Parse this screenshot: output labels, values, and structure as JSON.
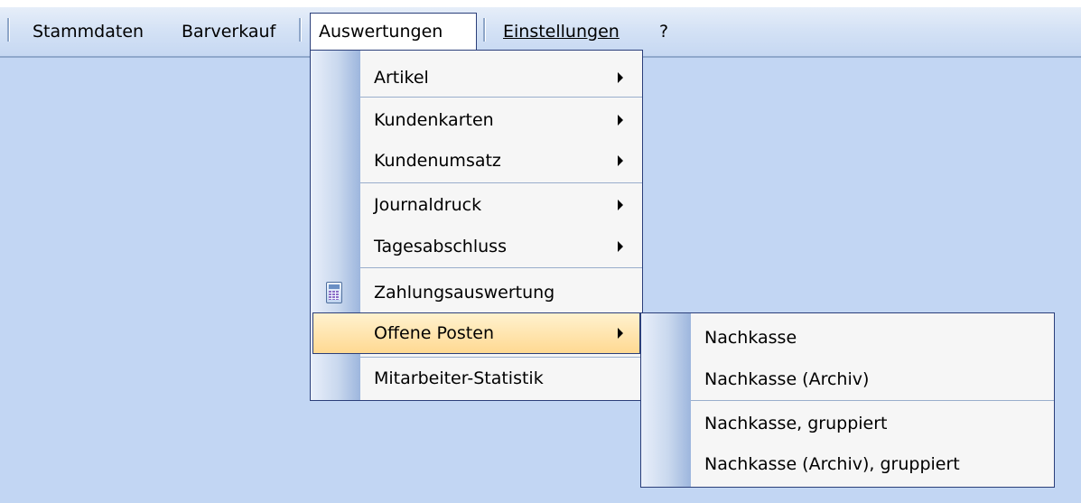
{
  "menubar": {
    "items": [
      "Stammdaten",
      "Barverkauf",
      "Auswertungen",
      "Einstellungen",
      "?"
    ]
  },
  "auswertungen_menu": {
    "items": [
      {
        "label": "Artikel",
        "submenu": true
      },
      {
        "label": "Kundenkarten",
        "submenu": true
      },
      {
        "label": "Kundenumsatz",
        "submenu": true
      },
      {
        "label": "Journaldruck",
        "submenu": true
      },
      {
        "label": "Tagesabschluss",
        "submenu": true
      },
      {
        "label": "Zahlungsauswertung",
        "submenu": false,
        "icon": "calculator-icon"
      },
      {
        "label": "Offene Posten",
        "submenu": true,
        "highlighted": true
      },
      {
        "label": "Mitarbeiter-Statistik",
        "submenu": false
      }
    ]
  },
  "offene_posten_submenu": {
    "items": [
      {
        "label": "Nachkasse"
      },
      {
        "label": "Nachkasse (Archiv)"
      },
      {
        "label": "Nachkasse, gruppiert"
      },
      {
        "label": "Nachkasse (Archiv), gruppiert"
      }
    ]
  },
  "colors": {
    "desktop": "#c2d6f3",
    "menu_border": "#2b3f7a",
    "highlight": "#ffd992"
  }
}
